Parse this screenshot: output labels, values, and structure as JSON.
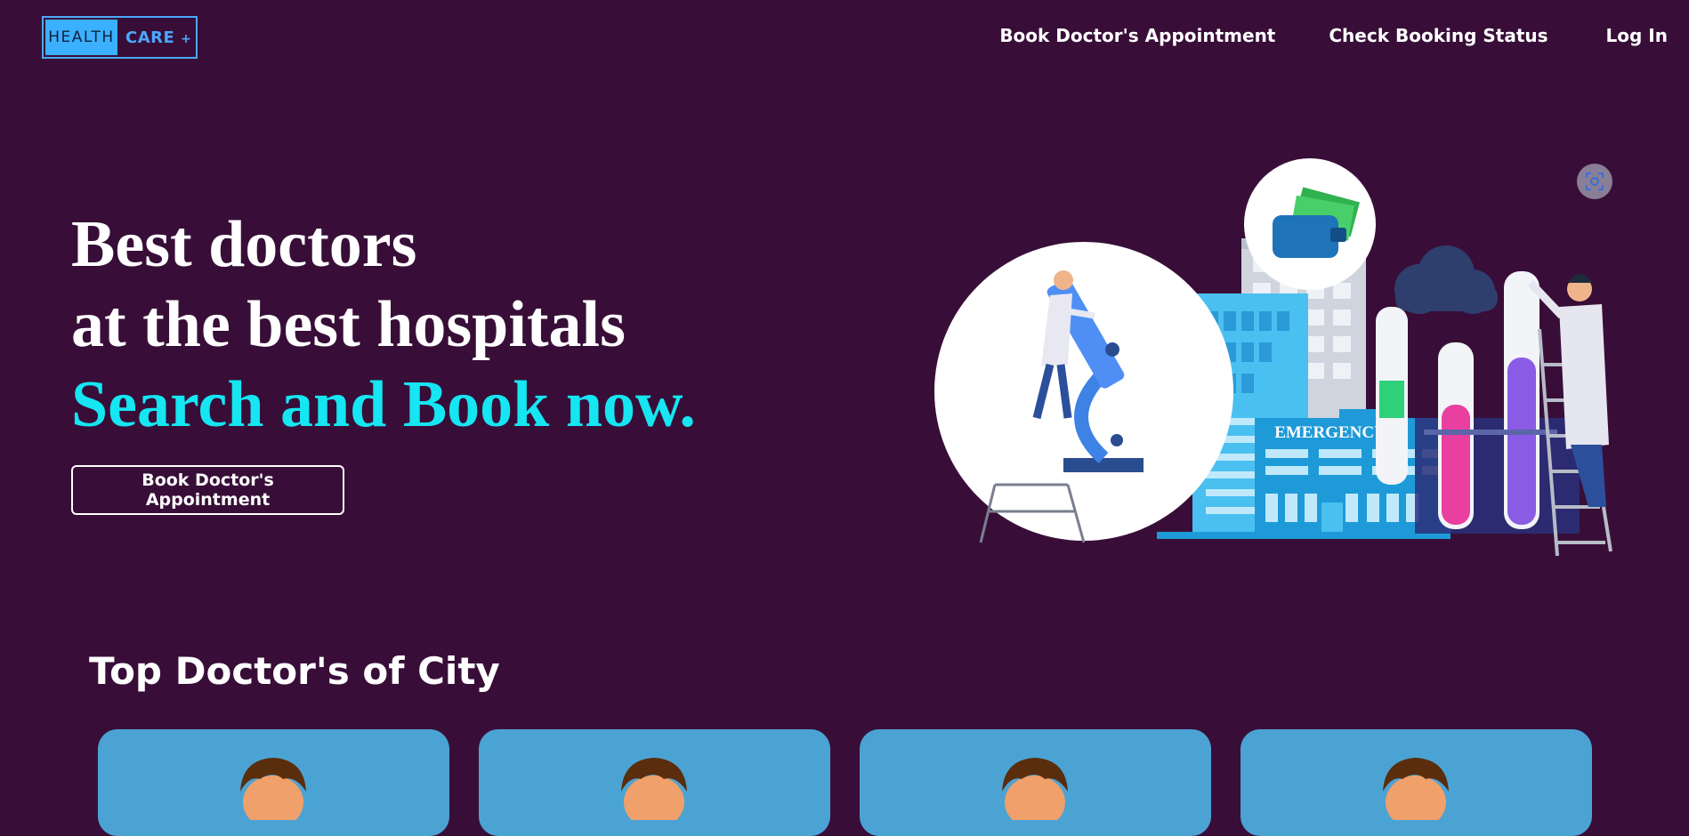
{
  "header": {
    "logo_left": "HEALTH",
    "logo_right": "CARE",
    "logo_plus": "+",
    "nav": [
      {
        "label": "Book Doctor's Appointment"
      },
      {
        "label": "Check Booking Status"
      },
      {
        "label": "Log In"
      }
    ]
  },
  "hero": {
    "line1": "Best doctors",
    "line2": "at the best hospitals",
    "line3": "Search and Book now.",
    "button_label": "Book Doctor's Appointment",
    "illustration_sign": "EMERGENCY"
  },
  "section": {
    "title": "Top Doctor's of City"
  },
  "cards": [
    {
      "icon": "doctor-avatar-icon"
    },
    {
      "icon": "doctor-avatar-icon"
    },
    {
      "icon": "doctor-avatar-icon"
    },
    {
      "icon": "doctor-avatar-icon"
    }
  ],
  "colors": {
    "background": "#380e38",
    "accent": "#15e6f2",
    "logo_blue": "#3ab0ff",
    "card_blue": "#4ba3d4"
  }
}
